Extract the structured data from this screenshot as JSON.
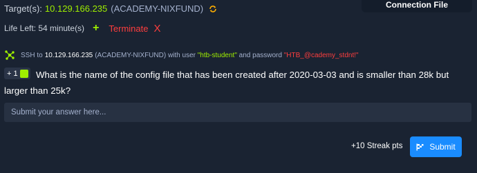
{
  "target": {
    "label": "Target(s):",
    "ip": "10.129.166.235",
    "name": "(ACADEMY-NIXFUND)",
    "refresh_icon": "refresh-icon"
  },
  "connection": {
    "label": "Connection File"
  },
  "life": {
    "text": "Life Left: 54 minute(s)",
    "extend_symbol": "+",
    "terminate_label": "Terminate",
    "terminate_symbol": "X"
  },
  "ssh": {
    "prefix": "SSH to",
    "ip": "10.129.166.235",
    "middle": "(ACADEMY-NIXFUND) with user",
    "user": "\"htb-student\"",
    "and_password": "and password",
    "password": "\"HTB_@cademy_stdnt!\""
  },
  "question": {
    "points": "+ 1",
    "text": "What is the name of the config file that has been created after 2020-03-03 and is smaller than 28k but larger than 25k?"
  },
  "answer": {
    "placeholder": "Submit your answer here..."
  },
  "footer": {
    "streak": "+10 Streak pts",
    "submit_label": "Submit"
  },
  "colors": {
    "background": "#1a2332",
    "accent_green": "#9fef00",
    "danger_red": "#ff3e3e",
    "primary_blue": "#1a8cff"
  }
}
